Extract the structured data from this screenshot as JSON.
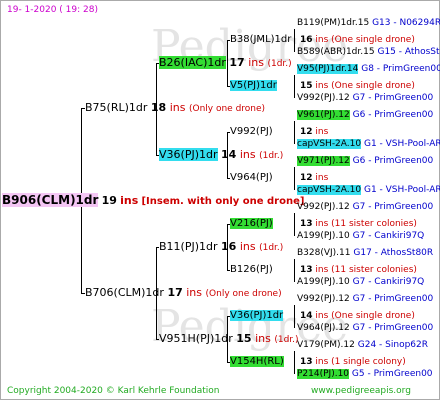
{
  "header": {
    "date": "19-  1-2020  ( 19: 28)"
  },
  "root": {
    "name": "B906(CLM)1dr",
    "ins_count": "19",
    "ins_word": "ins",
    "comment": "[Insem. with only one drone]"
  },
  "top": {
    "name": "B75(RL)1dr",
    "ins_count": "18",
    "ins_word": "ins",
    "comment": "(Only one drone)",
    "upper": {
      "name": "B26(IAC)1dr",
      "ins_count": "17",
      "ins_word": "ins",
      "note": "(1dr.)",
      "a": {
        "name": "B38(JML)1dr",
        "ins": "16",
        "note": "ins (One single drone)"
      },
      "b": {
        "name": "V5(PJ)1dr",
        "ins": "15",
        "note": "ins (One single drone)"
      }
    },
    "lower": {
      "name": "V36(PJ)1dr",
      "ins_count": "14",
      "ins_word": "ins",
      "note": "(1dr.)",
      "a": {
        "name": "V992(PJ)",
        "ins": "12",
        "note": "ins"
      },
      "b": {
        "name": "V964(PJ)",
        "ins": "12",
        "note": "ins"
      }
    }
  },
  "bottom": {
    "name": "B706(CLM)1dr",
    "ins_count": "17",
    "ins_word": "ins",
    "comment": "(Only one drone)",
    "upper": {
      "name": "B11(PJ)1dr",
      "ins_count": "16",
      "ins_word": "ins",
      "note": "(1dr.)",
      "a": {
        "name": "V216(PJ)",
        "ins": "13",
        "note": "ins (11 sister colonies)"
      },
      "b": {
        "name": "B126(PJ)",
        "ins": "13",
        "note": "ins (11 sister colonies)"
      }
    },
    "lower": {
      "name": "V951H(PJ)1dr",
      "ins_count": "15",
      "ins_word": "ins",
      "note": "(1dr.)",
      "a": {
        "name": "V36(PJ)1dr",
        "ins": "14",
        "note": "ins (One single drone)"
      },
      "b": {
        "name": "V154H(RL)",
        "ins": "13",
        "note": "ins (1 single colony)"
      }
    }
  },
  "gen4": [
    {
      "left": "B119(PM)1dr.15",
      "right": "G13 - N06294R"
    },
    {
      "left": "B589(ABR)1dr.15",
      "right": "G15 - AthosSt80R"
    },
    {
      "left": "V95(PJ)1dr.14",
      "right": "G8 - PrimGreen00"
    },
    {
      "left": "V992(PJ).12",
      "right": "G7 - PrimGreen00"
    },
    {
      "left": "V961(PJ).12",
      "right": "G6 - PrimGreen00"
    },
    {
      "left": "capVSH-2A.10",
      "right": "G1 - VSH-Pool-AR"
    },
    {
      "left": "V971(PJ).12",
      "right": "G6 - PrimGreen00"
    },
    {
      "left": "capVSH-2A.10",
      "right": "G1 - VSH-Pool-AR"
    },
    {
      "left": "V992(PJ).12",
      "right": "G7 - PrimGreen00"
    },
    {
      "left": "A199(PJ).10",
      "right": "G7 - Cankiri97Q"
    },
    {
      "left": "B328(VJ).11",
      "right": "G17 - AthosSt80R"
    },
    {
      "left": "A199(PJ).10",
      "right": "G7 - Cankiri97Q"
    },
    {
      "left": "V992(PJ).12",
      "right": "G7 - PrimGreen00"
    },
    {
      "left": "V964(PJ).12",
      "right": "G7 - PrimGreen00"
    },
    {
      "left": "V179(PM).12",
      "right": "G24 - Sinop62R"
    },
    {
      "left": "P214(PJ).10",
      "right": "G5 - PrimGreen00"
    }
  ],
  "footer": {
    "copyright": "Copyright 2004-2020 © Karl Kehrle Foundation",
    "site": "www.pedigreeapis.org"
  },
  "watermark": {
    "text": "Pedigree"
  },
  "colors": {
    "green": "#33dd33",
    "cyan": "#33ddee",
    "root": "#f4c6f4",
    "ins": "#cc0000",
    "info": "#0000cc"
  }
}
